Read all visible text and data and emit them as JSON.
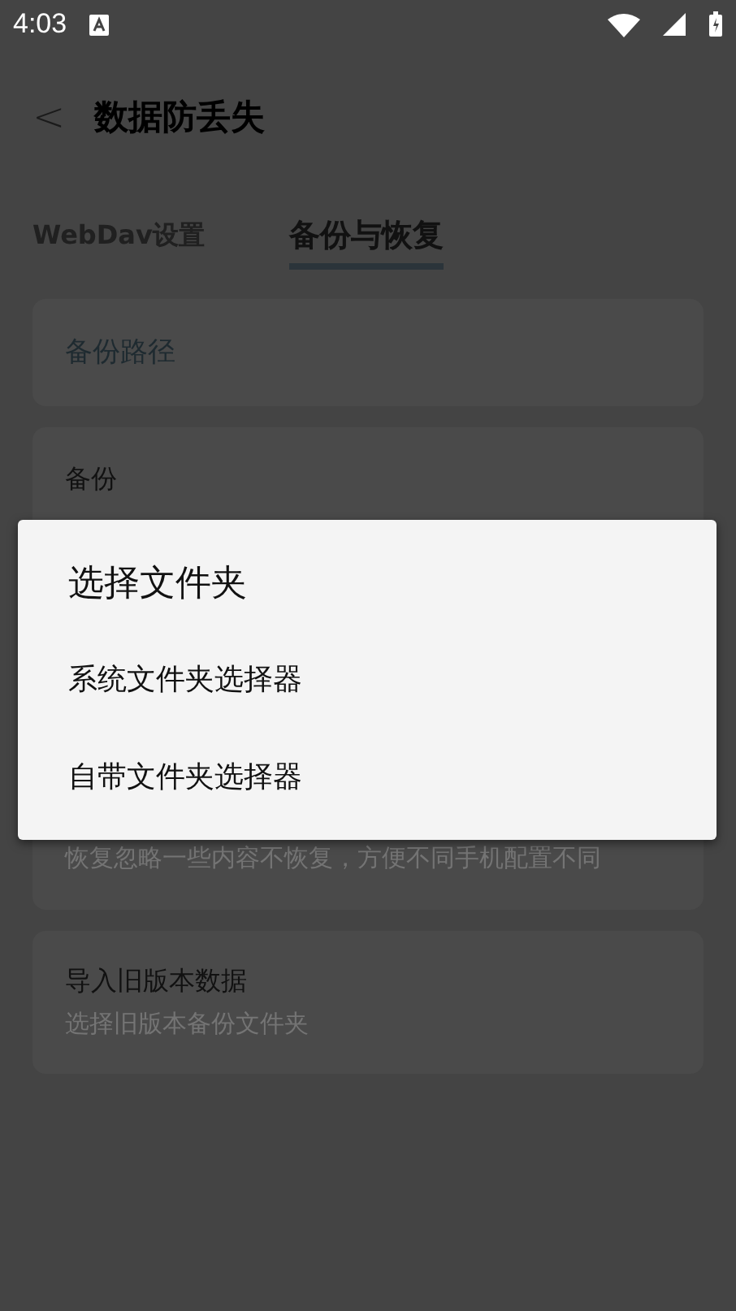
{
  "status_bar": {
    "time": "4:03"
  },
  "header": {
    "back": "<",
    "title": "数据防丢失"
  },
  "tabs": [
    {
      "label": "WebDav设置",
      "selected": false
    },
    {
      "label": "备份与恢复",
      "selected": true
    }
  ],
  "cards": [
    {
      "kind": "field",
      "placeholder": "备份路径"
    },
    {
      "kind": "item",
      "title": "备份"
    },
    {
      "kind": "item",
      "subtitle": "恢复忽略一些内容不恢复，方便不同手机配置不同"
    },
    {
      "kind": "item",
      "title": "导入旧版本数据",
      "subtitle": "选择旧版本备份文件夹"
    }
  ],
  "dialog": {
    "title": "选择文件夹",
    "options": [
      "系统文件夹选择器",
      "自带文件夹选择器"
    ]
  }
}
